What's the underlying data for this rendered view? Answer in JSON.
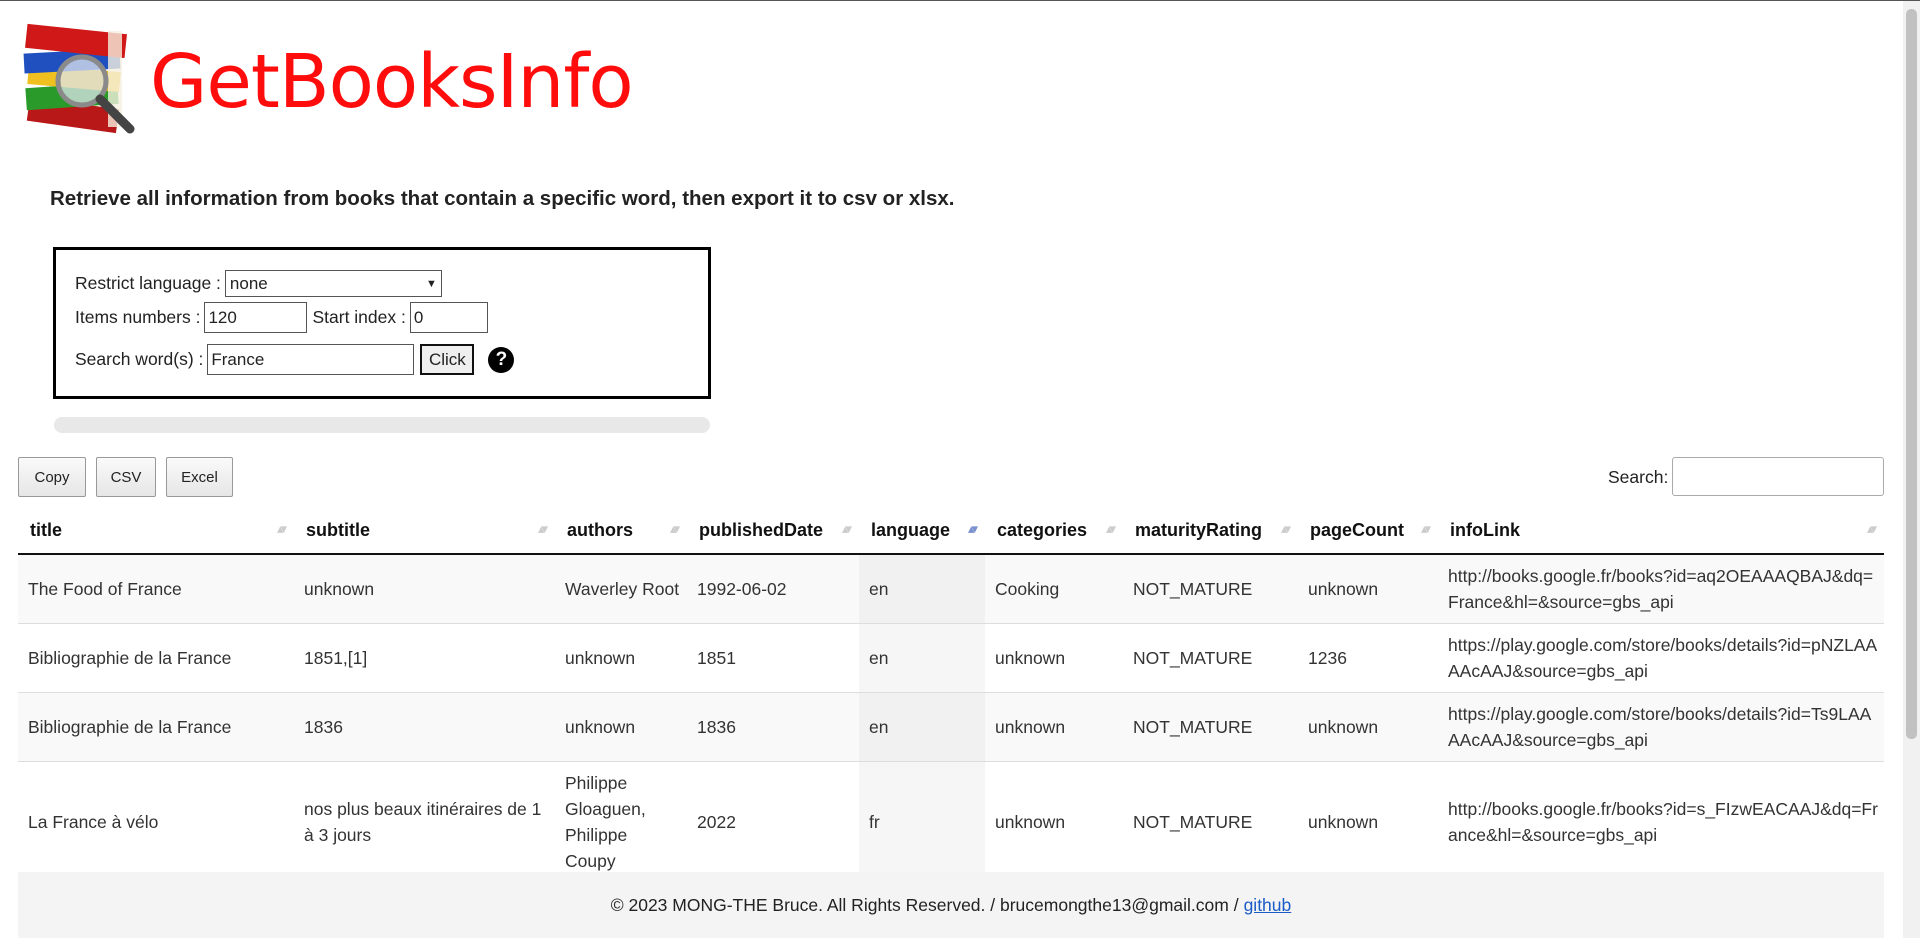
{
  "header": {
    "logo_text": "GetBooksInfo"
  },
  "tagline": "Retrieve all information from books that contain a specific word, then export it to csv or xlsx.",
  "form": {
    "language_label": "Restrict language :",
    "language_value": "none",
    "items_label": "Items numbers :",
    "items_value": "120",
    "start_label": "Start index :",
    "start_value": "0",
    "search_label": "Search word(s) :",
    "search_value": "France",
    "click_label": "Click",
    "help_symbol": "?"
  },
  "progress": {
    "value": 0
  },
  "toolbar": {
    "copy": "Copy",
    "csv": "CSV",
    "excel": "Excel",
    "search_label": "Search:",
    "search_value": ""
  },
  "table": {
    "columns": [
      "title",
      "subtitle",
      "authors",
      "publishedDate",
      "language",
      "categories",
      "maturityRating",
      "pageCount",
      "infoLink"
    ],
    "sorted_column": "language",
    "rows": [
      [
        "The Food of France",
        "unknown",
        "Waverley Root",
        "1992-06-02",
        "en",
        "Cooking",
        "NOT_MATURE",
        "unknown",
        "http://books.google.fr/books?id=aq2OEAAAQBAJ&dq=France&hl=&source=gbs_api"
      ],
      [
        "Bibliographie de la France",
        "1851,[1]",
        "unknown",
        "1851",
        "en",
        "unknown",
        "NOT_MATURE",
        "1236",
        "https://play.google.com/store/books/details?id=pNZLAAAAcAAJ&source=gbs_api"
      ],
      [
        "Bibliographie de la France",
        "1836",
        "unknown",
        "1836",
        "en",
        "unknown",
        "NOT_MATURE",
        "unknown",
        "https://play.google.com/store/books/details?id=Ts9LAAAAcAAJ&source=gbs_api"
      ],
      [
        "La France à vélo",
        "nos plus beaux itinéraires de 1 à 3 jours",
        "Philippe Gloaguen, Philippe Coupy",
        "2022",
        "fr",
        "unknown",
        "NOT_MATURE",
        "unknown",
        "http://books.google.fr/books?id=s_FIzwEACAAJ&dq=France&hl=&source=gbs_api"
      ]
    ]
  },
  "footer": {
    "text": "© 2023 MONG-THE Bruce. All Rights Reserved. / brucemongthe13@gmail.com /",
    "link": "github"
  }
}
